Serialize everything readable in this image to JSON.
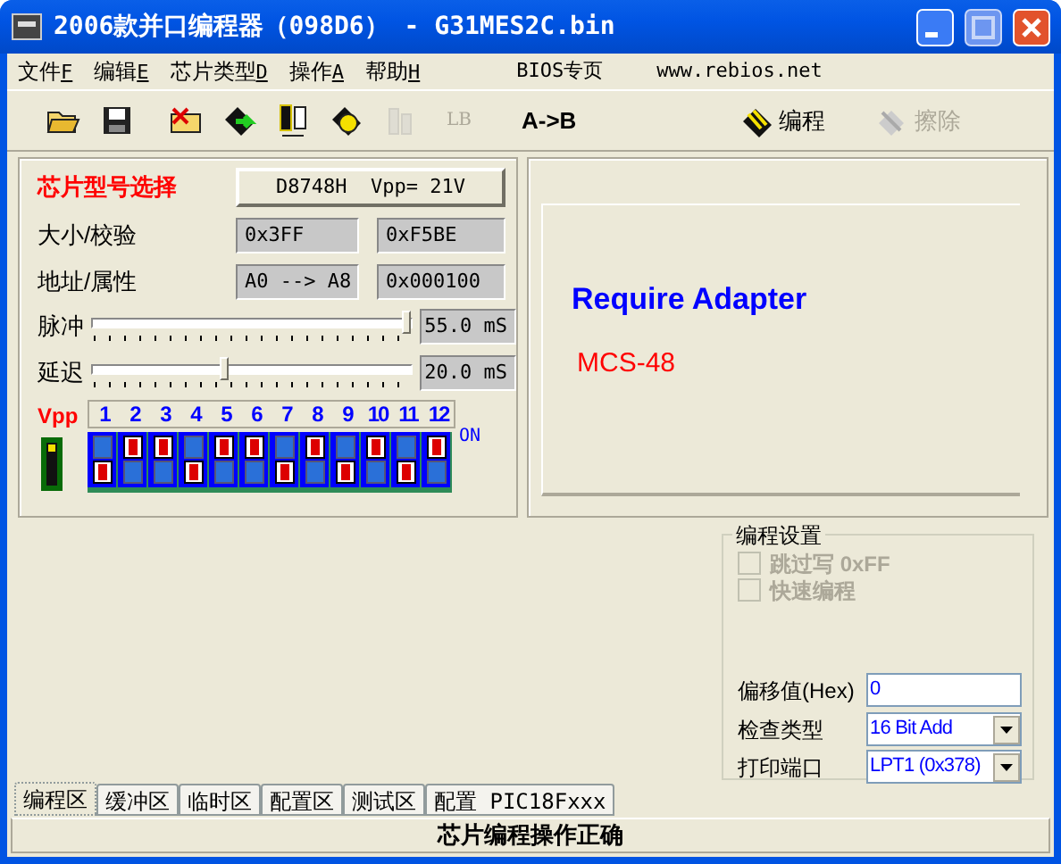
{
  "window": {
    "title": "2006款并口编程器（098D6） - G31MES2C.bin"
  },
  "menu": [
    {
      "label": "文件",
      "accel": "F"
    },
    {
      "label": "编辑",
      "accel": "E"
    },
    {
      "label": "芯片类型",
      "accel": "D"
    },
    {
      "label": "操作",
      "accel": "A"
    },
    {
      "label": "帮助",
      "accel": "H"
    }
  ],
  "menu_links": [
    "BIOS专页",
    "www.rebios.net"
  ],
  "toolbar": [
    {
      "kind": "icon",
      "disabled": false
    },
    {
      "kind": "icon",
      "disabled": false
    },
    {
      "kind": "icon",
      "disabled": false
    },
    {
      "kind": "icon",
      "disabled": false
    },
    {
      "kind": "icon",
      "disabled": false
    },
    {
      "kind": "icon",
      "disabled": false
    },
    {
      "kind": "icon",
      "disabled": true
    },
    {
      "kind": "text",
      "label": "LB",
      "disabled": true
    },
    {
      "kind": "text",
      "label": "A->B",
      "disabled": false
    },
    {
      "kind": "icon_text",
      "label": "编程",
      "disabled": false
    },
    {
      "kind": "icon_text",
      "label": "擦除",
      "disabled": true
    }
  ],
  "chip": {
    "label": "芯片型号选择",
    "button": "D8748H  Vpp= 21V"
  },
  "info_rows": [
    {
      "label": "大小/校验",
      "values": [
        "0x3FF",
        "0xF5BE"
      ]
    },
    {
      "label": "地址/属性",
      "values": [
        "A0 --> A8",
        "0x000100"
      ]
    }
  ],
  "sliders": [
    {
      "label": "脉冲",
      "level": 1.0,
      "reading": "55.0 mS"
    },
    {
      "label": "延迟",
      "level": 0.41,
      "reading": "20.0 mS"
    }
  ],
  "dip": {
    "vpp_label": "Vpp",
    "on_label": "ON",
    "switches": [
      {
        "number": "1",
        "on": false
      },
      {
        "number": "2",
        "on": true
      },
      {
        "number": "3",
        "on": true
      },
      {
        "number": "4",
        "on": false
      },
      {
        "number": "5",
        "on": true
      },
      {
        "number": "6",
        "on": true
      },
      {
        "number": "7",
        "on": false
      },
      {
        "number": "8",
        "on": true
      },
      {
        "number": "9",
        "on": false
      },
      {
        "number": "10",
        "on": true
      },
      {
        "number": "11",
        "on": false
      },
      {
        "number": "12",
        "on": true
      }
    ]
  },
  "adapter": {
    "title": "Require Adapter",
    "model": "MCS-48"
  },
  "settings": {
    "title": "编程设置",
    "options": [
      {
        "label": "跳过写 0xFF",
        "checked": false,
        "disabled": true
      },
      {
        "label": "快速编程",
        "checked": false,
        "disabled": true
      }
    ],
    "offset": {
      "label": "偏移值(Hex)",
      "value": "0"
    },
    "check_type": {
      "label": "检查类型",
      "value": "16 Bit Add"
    },
    "port": {
      "label": "打印端口",
      "value": "LPT1 (0x378)"
    }
  },
  "tabs": [
    {
      "label": "编程区",
      "selected": true
    },
    {
      "label": "缓冲区",
      "selected": false
    },
    {
      "label": "临时区",
      "selected": false
    },
    {
      "label": "配置区",
      "selected": false
    },
    {
      "label": "测试区",
      "selected": false
    },
    {
      "label": "配置 PIC18Fxxx",
      "selected": false
    }
  ],
  "status_bar": "芯片编程操作正确"
}
